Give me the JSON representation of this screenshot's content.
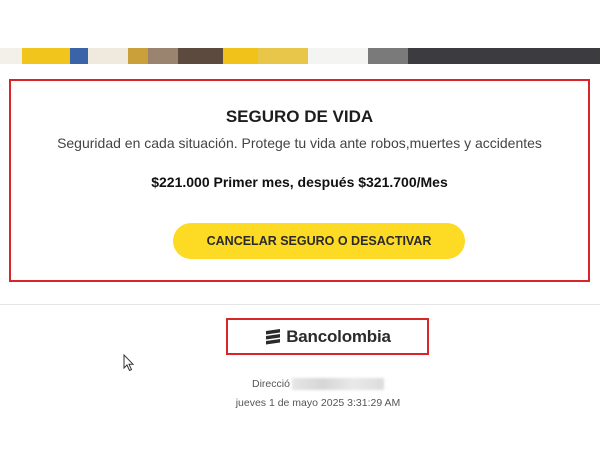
{
  "card": {
    "title": "SEGURO DE VIDA",
    "description": "Seguridad en cada situación. Protege tu vida ante robos,muertes y accidentes",
    "price": "$221.000 Primer mes, después $321.700/Mes",
    "cta_label": "CANCELAR SEGURO O DESACTIVAR"
  },
  "bank": {
    "name": "Bancolombia",
    "logo_icon": "bancolombia-stripes-icon"
  },
  "footer": {
    "address_label": "Direcció",
    "date": "jueves 1 de mayo 2025 3:31:29 AM"
  },
  "colors": {
    "accent_yellow": "#fdda24",
    "highlight_red": "#d9252a"
  }
}
